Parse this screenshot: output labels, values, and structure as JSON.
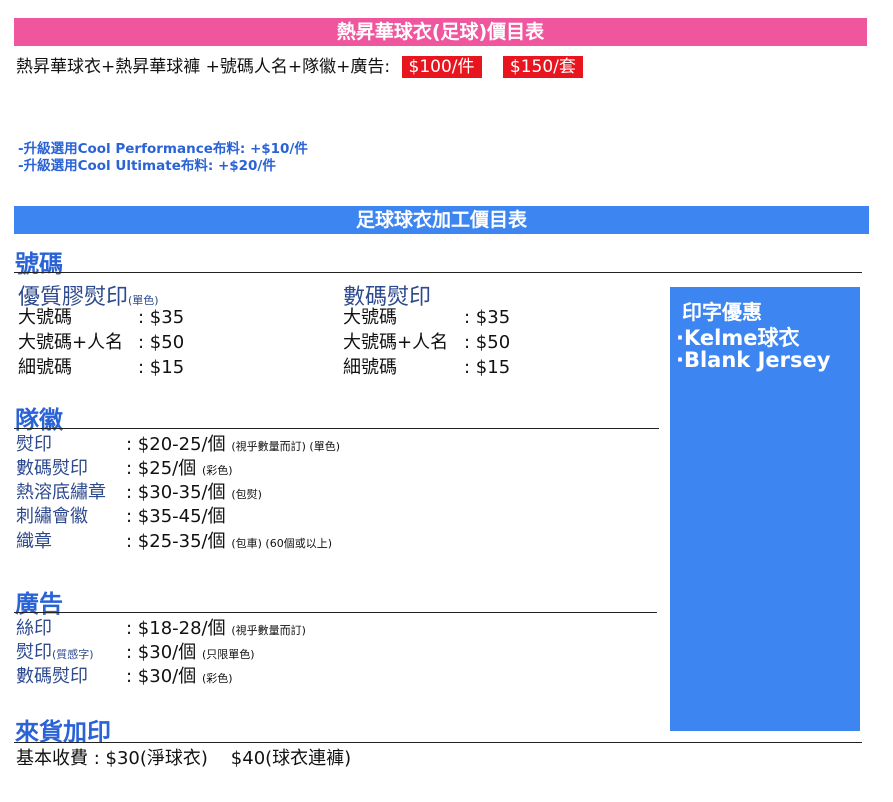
{
  "title_bar": "熱昇華球衣(足球)價目表",
  "package": {
    "desc": "熱昇華球衣+熱昇華球褲 +號碼人名+隊徽+廣告:",
    "price_piece": "$100/件",
    "price_set": "$150/套"
  },
  "upgrades": [
    "-升級選用Cool Performance布料: +$10/件",
    "-升級選用Cool Ultimate布料: +$20/件"
  ],
  "processing_bar": "足球球衣加工價目表",
  "numbers": {
    "heading": "號碼",
    "premium": {
      "title": "優質膠熨印",
      "note": "(單色)",
      "rows": [
        {
          "label": "大號碼",
          "price": ": $35"
        },
        {
          "label": "大號碼+人名",
          "price": ": $50"
        },
        {
          "label": "細號碼",
          "price": ": $15"
        }
      ]
    },
    "digital": {
      "title": "數碼熨印",
      "rows": [
        {
          "label": "大號碼",
          "price": ": $35"
        },
        {
          "label": "大號碼+人名",
          "price": ": $50"
        },
        {
          "label": "細號碼",
          "price": ": $15"
        }
      ]
    }
  },
  "badge": {
    "heading": "隊徽",
    "rows": [
      {
        "label": "熨印",
        "price": ": $20-25/個",
        "note": "(視乎數量而訂) (單色)"
      },
      {
        "label": "數碼熨印",
        "price": ": $25/個",
        "note": "(彩色)"
      },
      {
        "label": "熱溶底繡章",
        "price": ": $30-35/個",
        "note": "(包熨)"
      },
      {
        "label": "刺繡會徽",
        "price": ": $35-45/個",
        "note": ""
      },
      {
        "label": "織章",
        "price": ": $25-35/個",
        "note": "(包車) (60個或以上)"
      }
    ]
  },
  "ads": {
    "heading": "廣告",
    "rows": [
      {
        "label": "絲印",
        "label_note": "",
        "price": ": $18-28/個",
        "note": "(視乎數量而訂)"
      },
      {
        "label": "熨印",
        "label_note": "(質感字)",
        "price": ": $30/個",
        "note": "(只限單色)"
      },
      {
        "label": "數碼熨印",
        "label_note": "",
        "price": ": $30/個",
        "note": "(彩色)"
      }
    ]
  },
  "incoming": {
    "heading": "來貨加印",
    "text": "基本收費 : $30(淨球衣)    $40(球衣連褲)"
  },
  "promo": {
    "title": "印字優惠",
    "items": [
      "·Kelme球衣",
      "·Blank Jersey"
    ]
  },
  "colors": {
    "pink": "#f0569e",
    "blue": "#3d86f2",
    "red": "#e8141e",
    "heading_blue": "#2a63d6",
    "label_navy": "#2e4a8e"
  }
}
